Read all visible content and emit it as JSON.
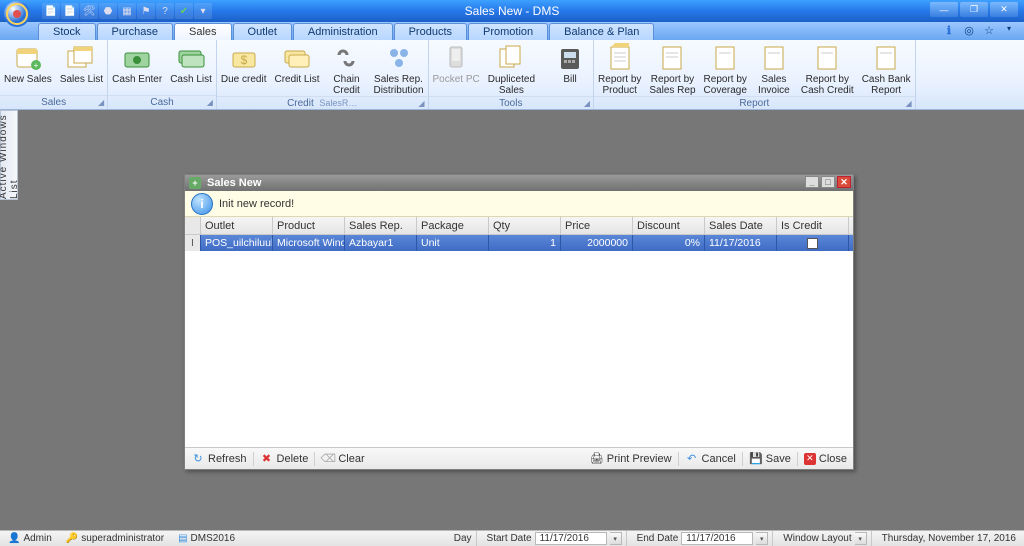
{
  "app": {
    "title": "Sales New - DMS"
  },
  "quick_actions": [
    "doc-icon",
    "doc-add-icon",
    "toolbelt-icon",
    "stamp-icon",
    "grid-icon",
    "flag-icon",
    "help-icon",
    "check-icon",
    "dropdown-icon"
  ],
  "menu_tabs": [
    "Stock",
    "Purchase",
    "Sales",
    "Outlet",
    "Administration",
    "Products",
    "Promotion",
    "Balance & Plan"
  ],
  "menu_active": "Sales",
  "ribbon": {
    "groups": [
      {
        "name": "Sales",
        "marker": true,
        "items": [
          {
            "label": "New Sales"
          },
          {
            "label": "Sales List"
          }
        ]
      },
      {
        "name": "Cash",
        "marker": true,
        "items": [
          {
            "label": "Cash Enter"
          },
          {
            "label": "Cash List"
          }
        ]
      },
      {
        "name": "Credit",
        "marker": true,
        "items": [
          {
            "label": "Due credit"
          },
          {
            "label": "Credit List"
          },
          {
            "label": "Chain\nCredit"
          },
          {
            "label": "Sales Rep.\nDistribution"
          }
        ],
        "subname": "SalesR…"
      },
      {
        "name": "Tools",
        "marker": true,
        "items": [
          {
            "label": "Pocket PC",
            "disabled": true
          },
          {
            "label": "Dupliceted\nSales"
          },
          {
            "label": "",
            "spacer": true
          },
          {
            "label": "Bill"
          }
        ]
      },
      {
        "name": "Report",
        "marker": true,
        "items": [
          {
            "label": "Report by\nProduct"
          },
          {
            "label": "Report by\nSales Rep"
          },
          {
            "label": "Report by\nCoverage"
          },
          {
            "label": "Sales\nInvoice"
          },
          {
            "label": "Report by\nCash Credit"
          },
          {
            "label": "Cash Bank\nReport"
          }
        ]
      }
    ]
  },
  "dock_left": "Active Windows List",
  "sales_window": {
    "title": "Sales New",
    "info": "Init new record!",
    "columns": [
      "Outlet",
      "Product",
      "Sales Rep.",
      "Package",
      "Qty",
      "Price",
      "Discount",
      "Sales Date",
      "Is Credit"
    ],
    "row": {
      "outlet": "POS_uilchiluulegch",
      "product": "Microsoft Windo...",
      "salesrep": "Azbayar1",
      "package": "Unit",
      "qty": "1",
      "price": "2000000",
      "discount": "0%",
      "salesdate": "11/17/2016",
      "iscredit": false
    },
    "buttons": {
      "refresh": "Refresh",
      "delete": "Delete",
      "clear": "Clear",
      "preview": "Print Preview",
      "cancel": "Cancel",
      "save": "Save",
      "close": "Close"
    }
  },
  "statusbar": {
    "admin": "Admin",
    "user": "superadministrator",
    "db": "DMS2016",
    "day_label": "Day",
    "start_label": "Start Date",
    "start_val": "11/17/2016",
    "end_label": "End Date",
    "end_val": "11/17/2016",
    "layout_label": "Window Layout",
    "datetime": "Thursday, November 17, 2016"
  },
  "colors": {
    "accent": "#2a72d8",
    "sel": "#3f6cc4"
  }
}
